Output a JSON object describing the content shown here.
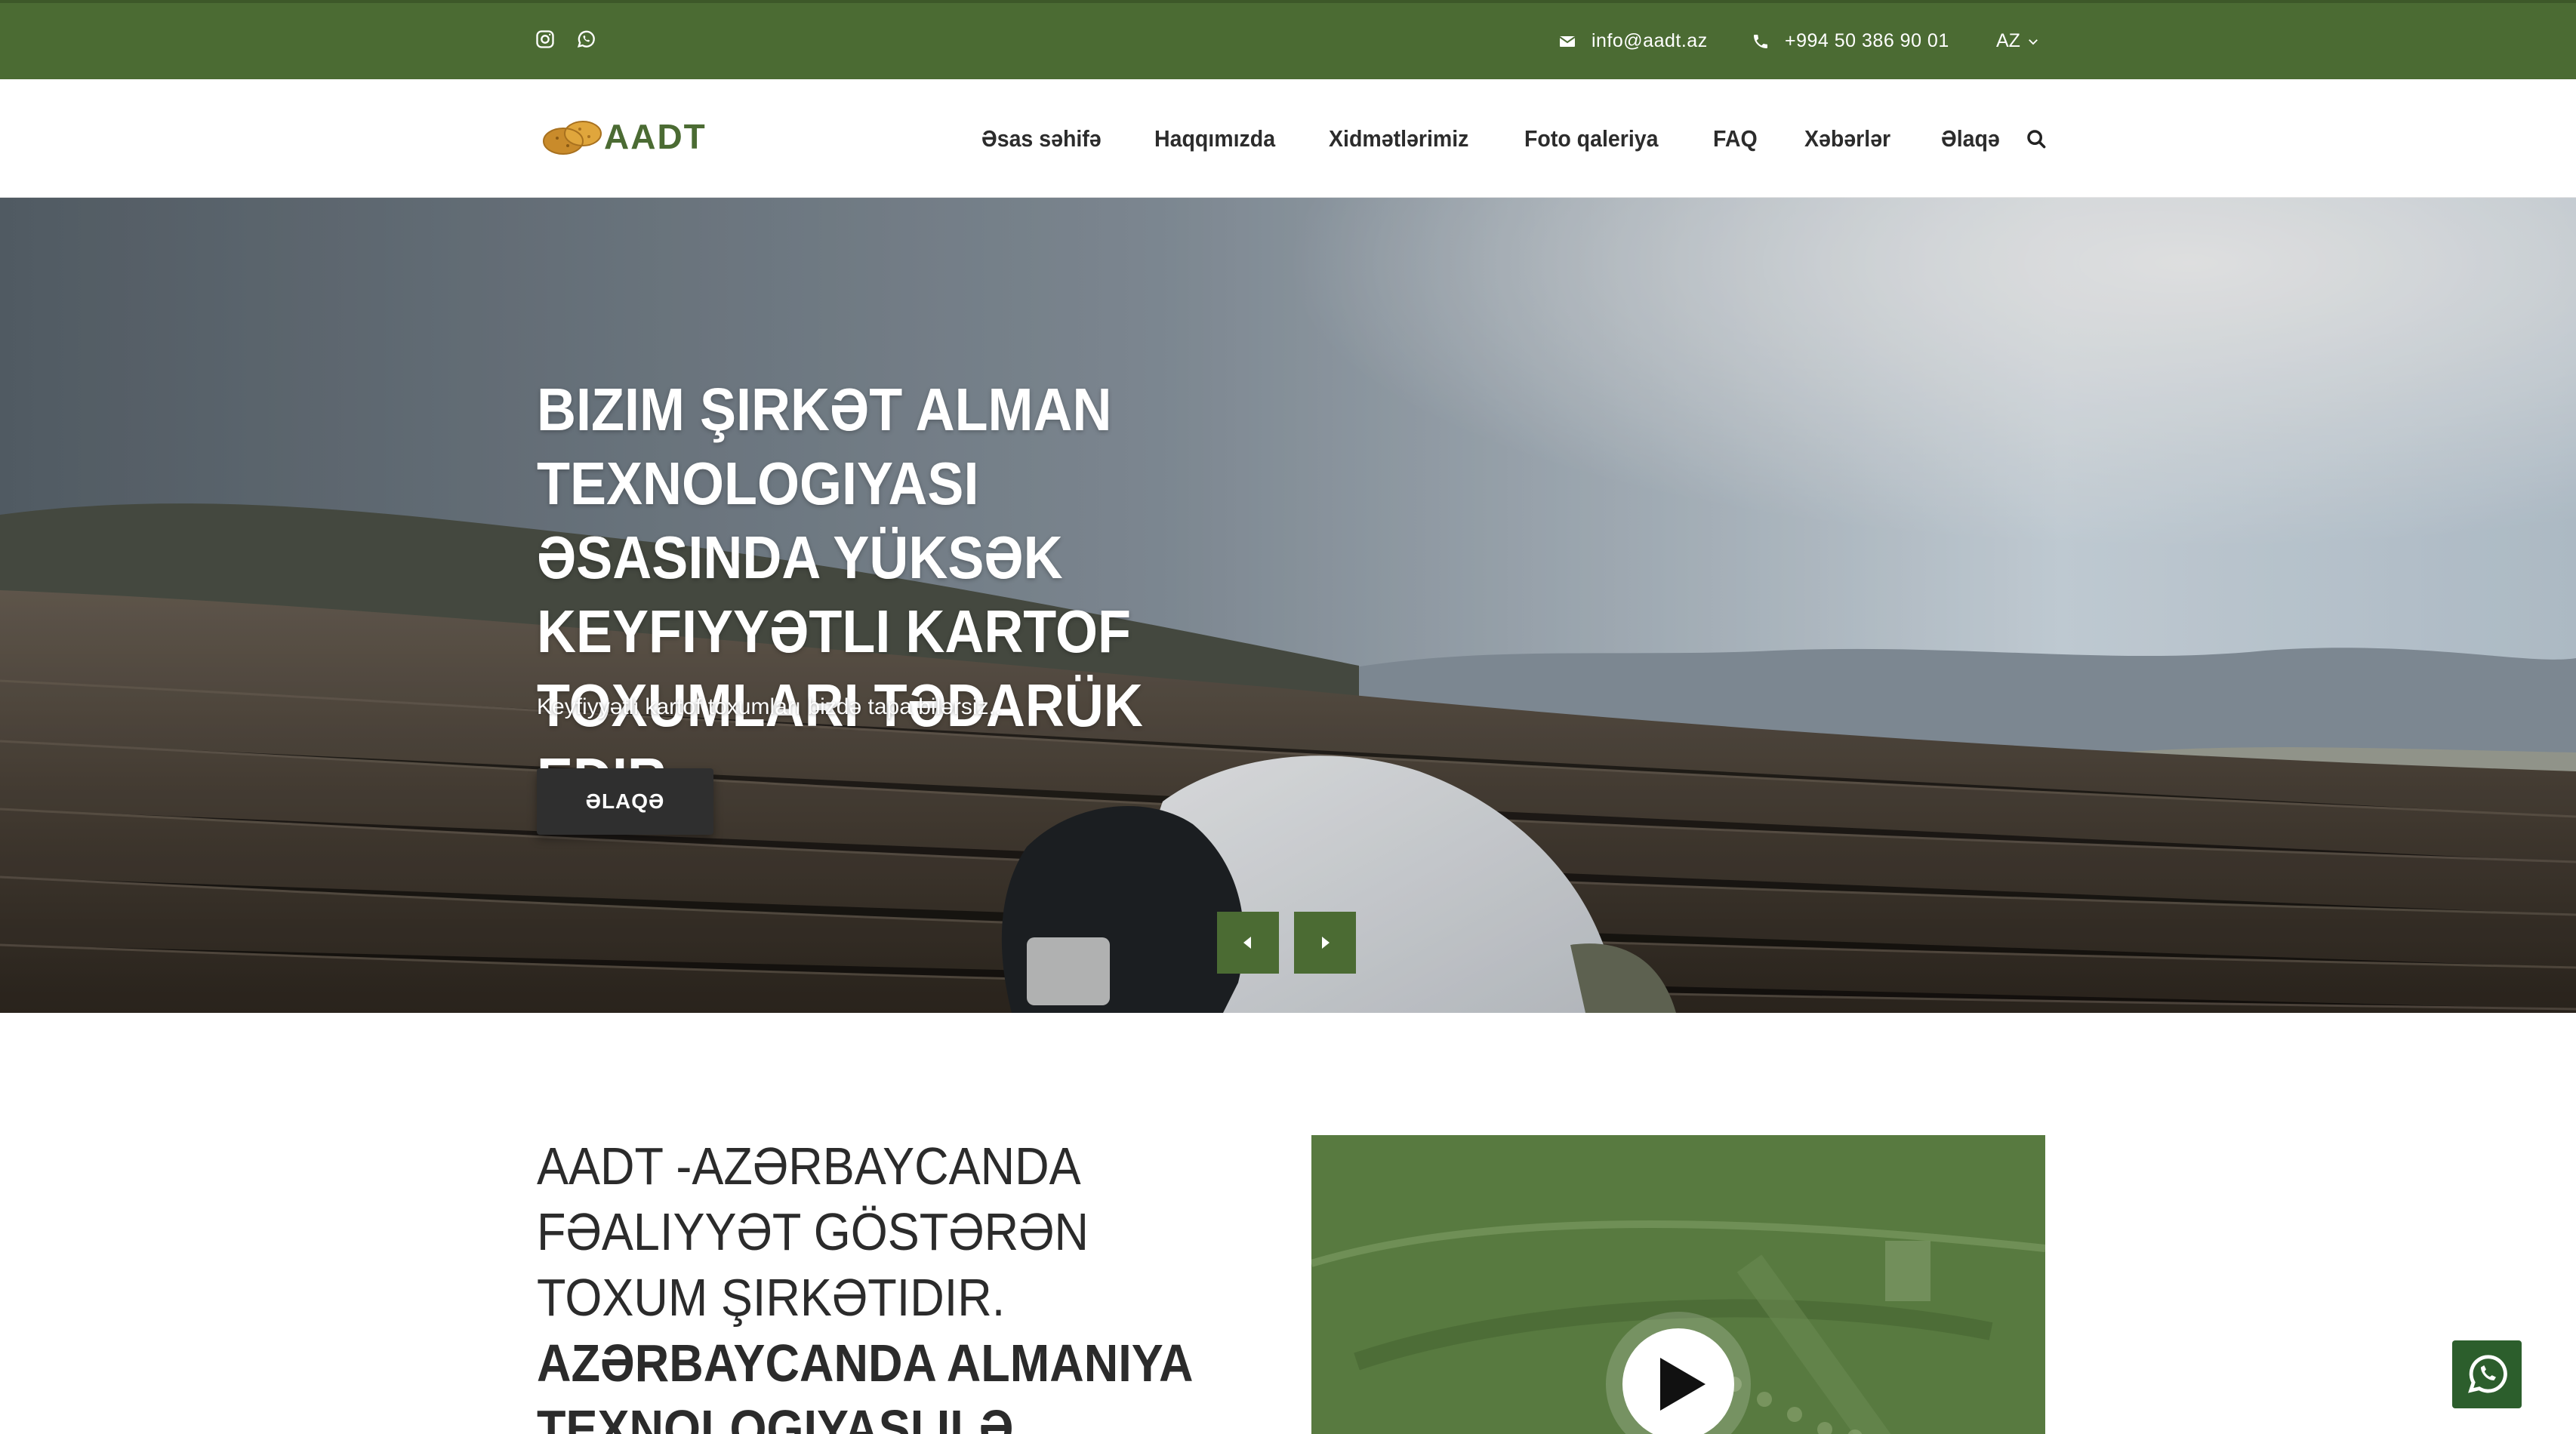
{
  "topbar": {
    "social": [
      {
        "icon": "instagram-icon"
      },
      {
        "icon": "whatsapp-icon"
      }
    ],
    "email": "info@aadt.az",
    "phone": "+994 50 386 90 01",
    "language": "AZ"
  },
  "header": {
    "logo_text": "AADT",
    "nav": [
      "Əsas səhifə",
      "Haqqımızda",
      "Xidmətlərimiz",
      "Foto qaleriya",
      "FAQ",
      "Xəbərlər",
      "Əlaqə"
    ],
    "search_icon": "search-icon"
  },
  "hero": {
    "title": "Bizim şirkət alman texnologiyası əsasında yüksək keyfiyyətli kartof toxumları tədarük edir.",
    "subtitle": "Keyfiyyətli kartof toxumları bizdə tapa bilərsiz..",
    "button": "ƏLAQƏ"
  },
  "about": {
    "title_light": "AADT -Azərbaycanda fəaliyyət göstərən toxum şirkətidir.",
    "title_bold": "Azərbaycanda Almaniya texnologiyası ilə"
  },
  "colors": {
    "brand_green": "#4b6b33",
    "dark_button": "#2f2f2f",
    "whatsapp_float": "#2c5e2c"
  }
}
